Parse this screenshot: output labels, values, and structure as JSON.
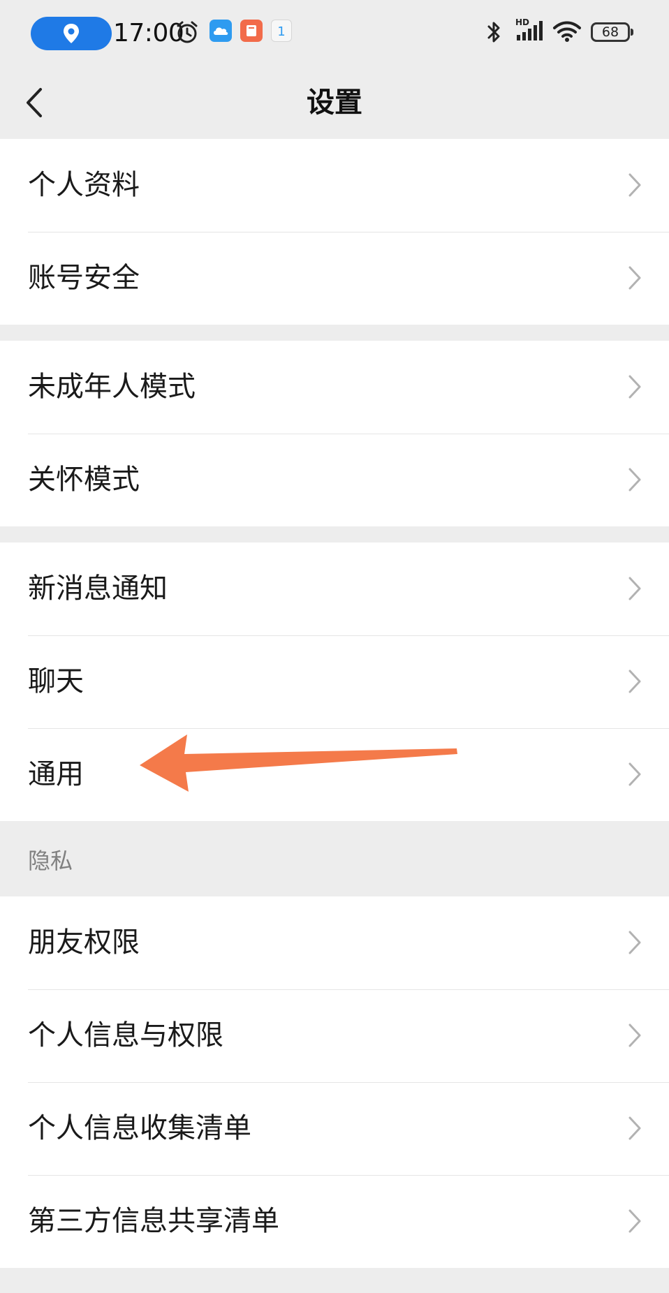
{
  "status_bar": {
    "time": "17:00",
    "location_icon": "location-pin-icon",
    "calendar_day": "1",
    "battery": "68",
    "icons": [
      "alarm-icon",
      "cloud-app-icon",
      "mail-app-icon",
      "calendar-app-icon",
      "bluetooth-icon",
      "hd-signal-icon",
      "wifi-icon",
      "battery-icon"
    ]
  },
  "header": {
    "title": "设置",
    "back_icon": "chevron-left-icon"
  },
  "groups": [
    {
      "items": [
        {
          "label": "个人资料"
        },
        {
          "label": "账号安全"
        }
      ]
    },
    {
      "items": [
        {
          "label": "未成年人模式"
        },
        {
          "label": "关怀模式"
        }
      ]
    },
    {
      "items": [
        {
          "label": "新消息通知"
        },
        {
          "label": "聊天"
        },
        {
          "label": "通用"
        }
      ]
    },
    {
      "section_title": "隐私",
      "items": [
        {
          "label": "朋友权限"
        },
        {
          "label": "个人信息与权限"
        },
        {
          "label": "个人信息收集清单"
        },
        {
          "label": "第三方信息共享清单"
        }
      ]
    }
  ],
  "colors": {
    "background": "#ededed",
    "row": "#ffffff",
    "text": "#1a1a1a",
    "chevron": "#b2b2b2",
    "section_label": "#808080",
    "annotation_arrow": "#f47a4a",
    "location_pill": "#1f7ae6"
  }
}
